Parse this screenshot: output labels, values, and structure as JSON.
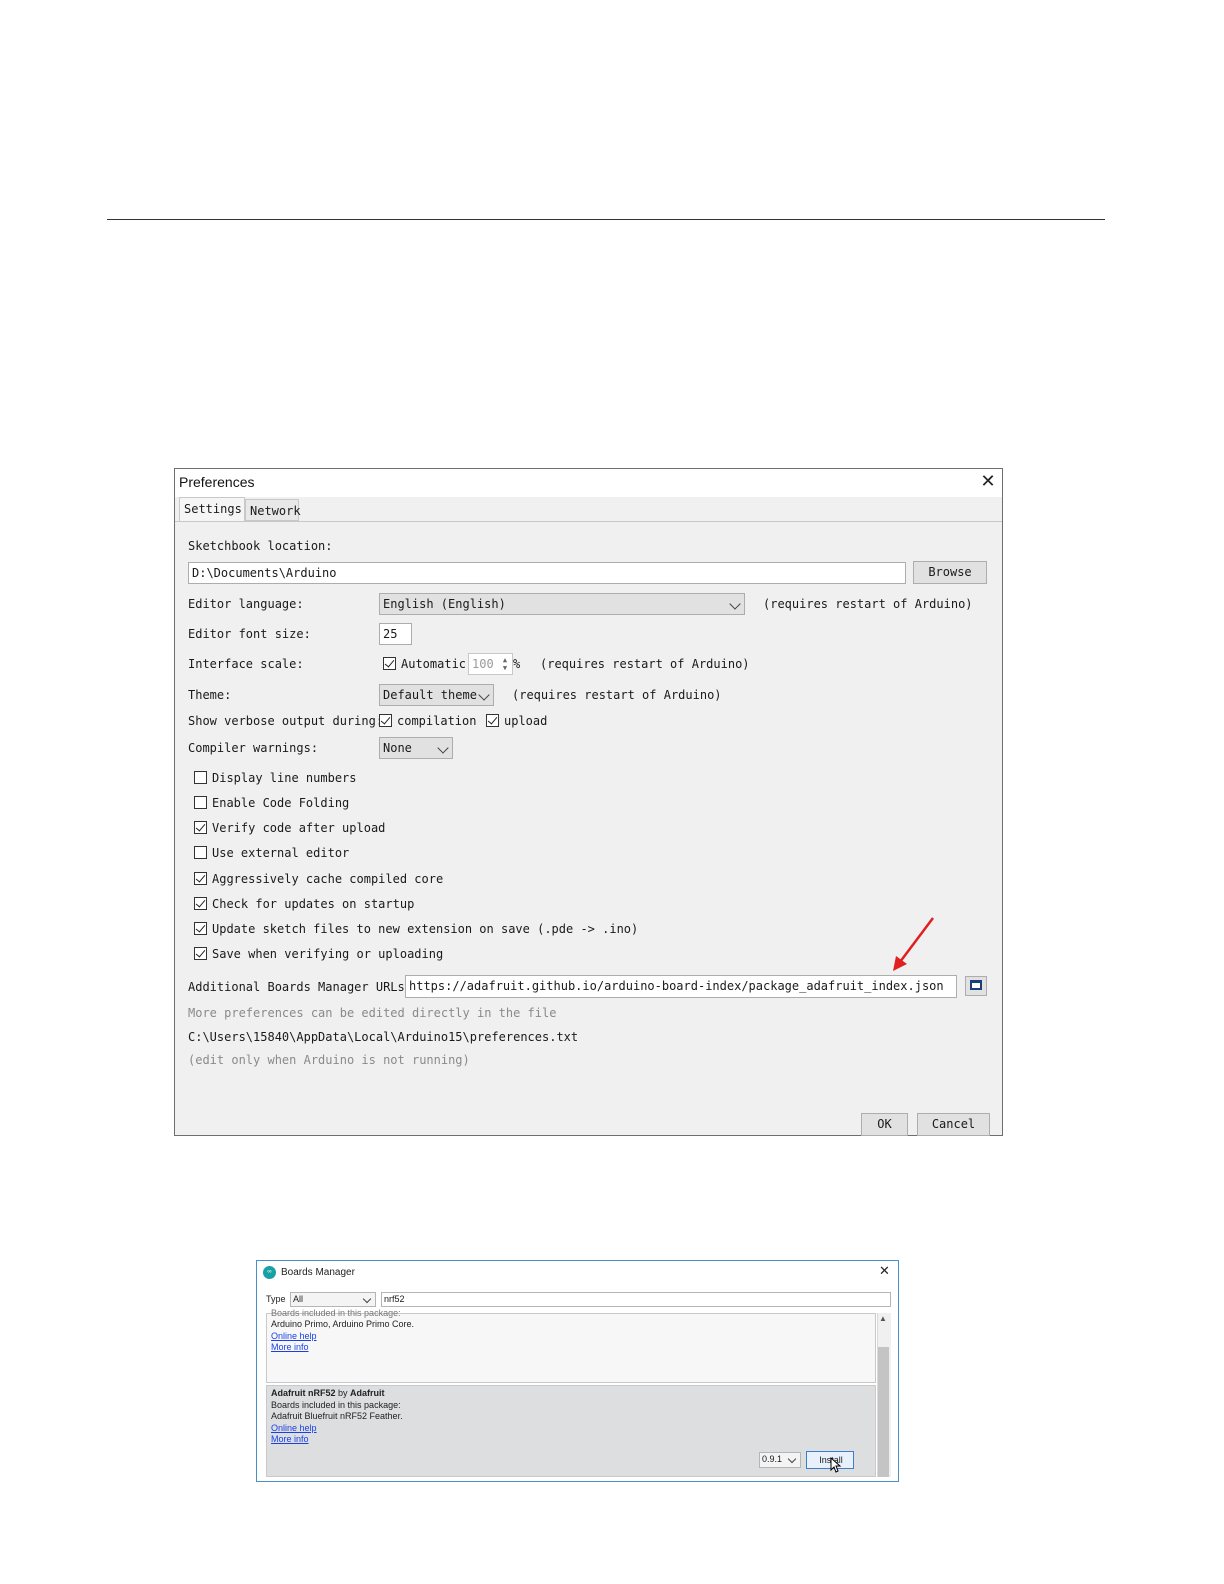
{
  "preferences": {
    "title": "Preferences",
    "close_glyph": "✕",
    "tabs": {
      "settings": "Settings",
      "network": "Network"
    },
    "sketchbook_label": "Sketchbook location:",
    "sketchbook_value": "D:\\Documents\\Arduino",
    "browse_label": "Browse",
    "editor_language_label": "Editor language:",
    "editor_language_value": "English (English)",
    "requires_restart": "(requires restart of Arduino)",
    "font_size_label": "Editor font size:",
    "font_size_value": "25",
    "interface_scale_label": "Interface scale:",
    "automatic_label": "Automatic",
    "automatic_checked": true,
    "scale_value": "100",
    "percent": "%",
    "theme_label": "Theme:",
    "theme_value": "Default theme",
    "verbose_label": "Show verbose output during:",
    "compilation_label": "compilation",
    "upload_label": "upload",
    "compiler_warnings_label": "Compiler warnings:",
    "compiler_warnings_value": "None",
    "checkboxes": [
      {
        "label": "Display line numbers",
        "checked": false
      },
      {
        "label": "Enable Code Folding",
        "checked": false
      },
      {
        "label": "Verify code after upload",
        "checked": true
      },
      {
        "label": "Use external editor",
        "checked": false
      },
      {
        "label": "Aggressively cache compiled core",
        "checked": true
      },
      {
        "label": "Check for updates on startup",
        "checked": true
      },
      {
        "label": "Update sketch files to new extension on save (.pde -> .ino)",
        "checked": true
      },
      {
        "label": "Save when verifying or uploading",
        "checked": true
      }
    ],
    "boards_urls_label": "Additional Boards Manager URLs:",
    "boards_urls_value": "https://adafruit.github.io/arduino-board-index/package_adafruit_index.json",
    "more_prefs_note": "More preferences can be edited directly in the file",
    "prefs_path": "C:\\Users\\15840\\AppData\\Local\\Arduino15\\preferences.txt",
    "edit_note": "(edit only when Arduino is not running)",
    "ok_label": "OK",
    "cancel_label": "Cancel",
    "arrow_color": "#e02020"
  },
  "boards_manager": {
    "title": "Boards Manager",
    "close_glyph": "✕",
    "type_label": "Type",
    "type_value": "All",
    "search_value": "nrf52",
    "entry1": {
      "partial_line": "Boards included in this package:",
      "boards": "Arduino Primo, Arduino Primo Core.",
      "online_help": "Online help",
      "more_info": "More info"
    },
    "entry2": {
      "name": "Adafruit nRF52",
      "by": " by ",
      "author": "Adafruit",
      "included": "Boards included in this package:",
      "boards": "Adafruit Bluefruit nRF52 Feather.",
      "online_help": "Online help",
      "more_info": "More info",
      "version": "0.9.1",
      "install_label": "Install"
    }
  }
}
